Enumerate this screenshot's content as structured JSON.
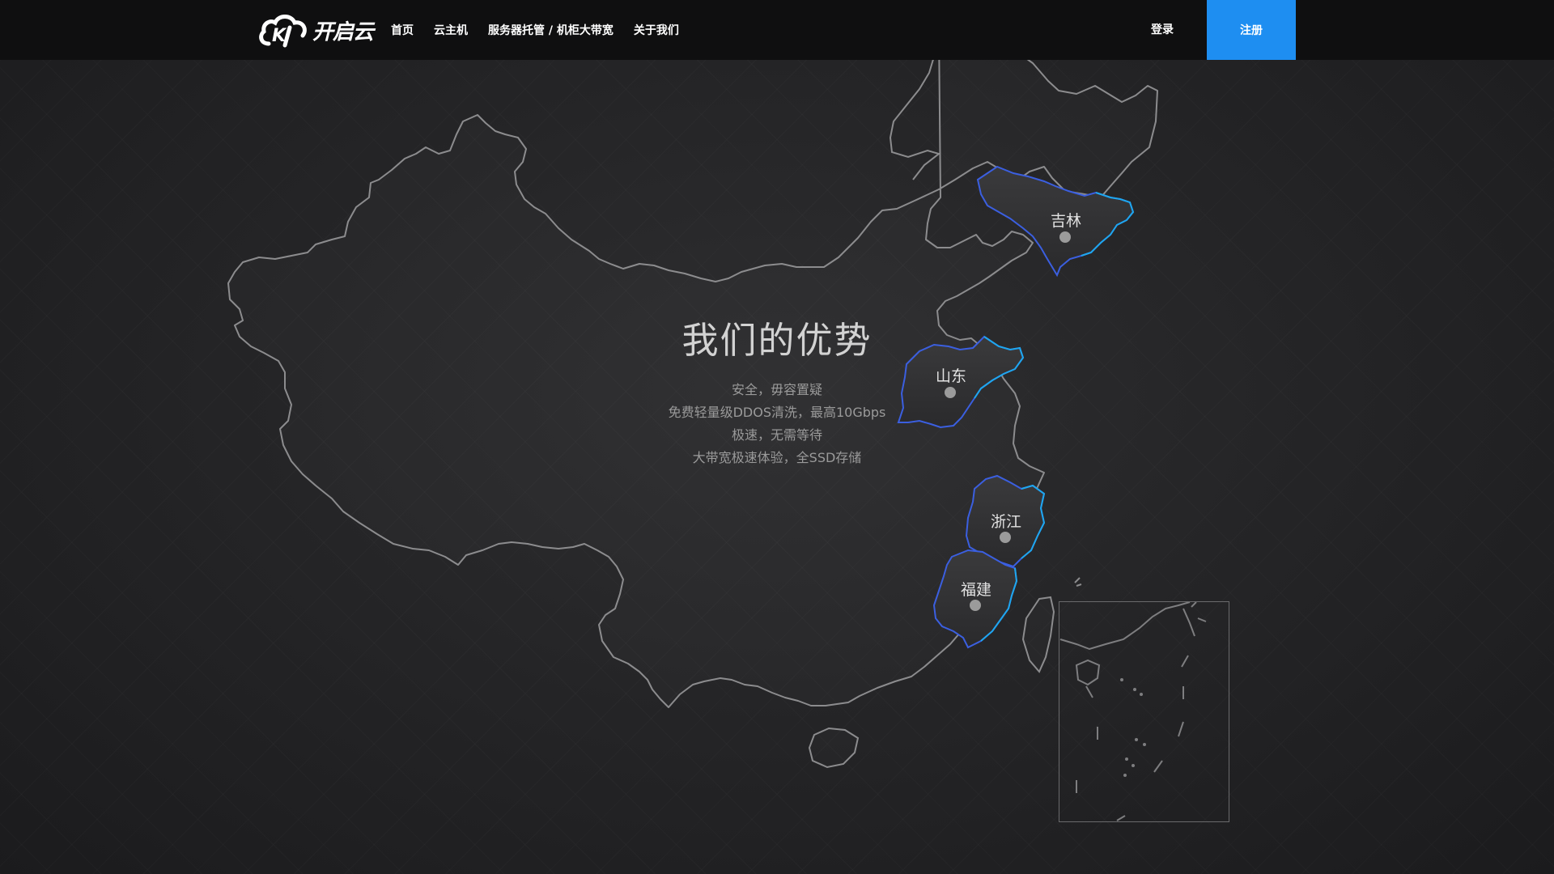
{
  "brand": {
    "name": "开启云"
  },
  "nav": {
    "items": [
      {
        "label": "首页"
      },
      {
        "label": "云主机"
      },
      {
        "label": "服务器托管 / 机柜大带宽"
      },
      {
        "label": "关于我们"
      }
    ],
    "login_label": "登录",
    "register_label": "注册"
  },
  "main": {
    "title": "我们的优势",
    "lines": [
      "安全，毋容置疑",
      "免费轻量级DDOS清洗，最高10Gbps",
      "极速，无需等待",
      "大带宽极速体验，全SSD存储"
    ]
  },
  "provinces": [
    {
      "name": "吉林"
    },
    {
      "name": "山东"
    },
    {
      "name": "浙江"
    },
    {
      "name": "福建"
    }
  ],
  "colors": {
    "accent": "#1e8ef1",
    "navbar_bg": "#0f0f10",
    "map_outline": "#8a8a8c",
    "province_outline_blue": "#3b5fe0",
    "province_outline_cyan": "#1ea7ee"
  }
}
